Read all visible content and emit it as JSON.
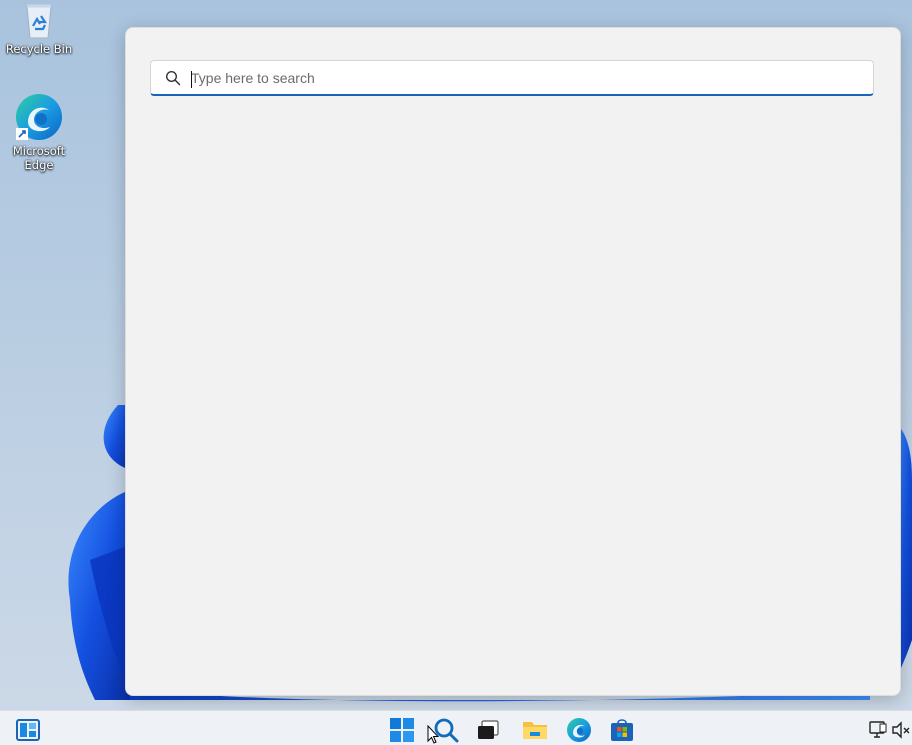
{
  "desktop": {
    "icons": [
      {
        "label": "Recycle Bin",
        "icon": "recycle-bin-icon"
      },
      {
        "label": "Microsoft Edge",
        "icon": "edge-icon"
      }
    ]
  },
  "search_panel": {
    "search_box": {
      "placeholder": "Type here to search",
      "value": "",
      "icon": "search-icon"
    }
  },
  "taskbar": {
    "items": [
      {
        "name": "widgets",
        "icon": "widgets-icon"
      },
      {
        "name": "start",
        "icon": "windows-logo-icon"
      },
      {
        "name": "search",
        "icon": "search-icon"
      },
      {
        "name": "task-view",
        "icon": "task-view-icon"
      },
      {
        "name": "file-explorer",
        "icon": "folder-icon"
      },
      {
        "name": "microsoft-edge",
        "icon": "edge-icon"
      },
      {
        "name": "microsoft-store",
        "icon": "store-icon"
      }
    ],
    "tray": [
      {
        "name": "network",
        "icon": "network-icon"
      },
      {
        "name": "volume",
        "icon": "volume-muted-icon"
      }
    ]
  },
  "colors": {
    "accent": "#1a63b8",
    "panel_bg": "#f2f2f2",
    "taskbar_bg": "#eef1f6",
    "wallpaper_bloom": "#1f5fe0"
  }
}
